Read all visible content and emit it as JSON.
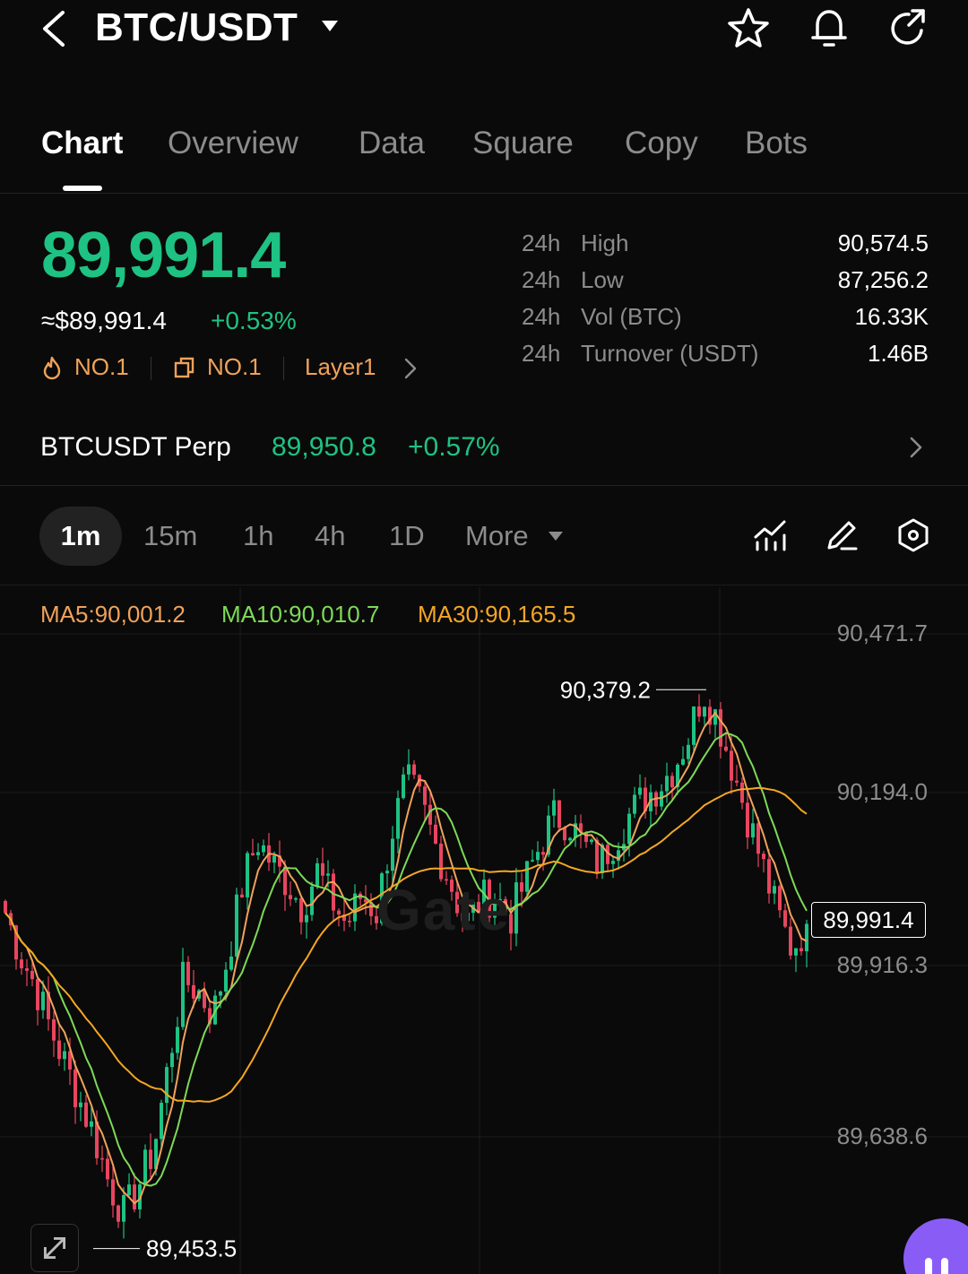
{
  "header": {
    "pair": "BTC/USDT"
  },
  "tabs": [
    {
      "label": "Chart",
      "active": true
    },
    {
      "label": "Overview"
    },
    {
      "label": "Data"
    },
    {
      "label": "Square"
    },
    {
      "label": "Copy"
    },
    {
      "label": "Bots"
    }
  ],
  "ticker": {
    "last_price": "89,991.4",
    "approx_usd": "≈$89,991.4",
    "change_pct": "+0.53%",
    "rank1": "NO.1",
    "rank2": "NO.1",
    "category": "Layer1"
  },
  "stats": [
    {
      "prefix": "24h",
      "label": "High",
      "value": "90,574.5"
    },
    {
      "prefix": "24h",
      "label": "Low",
      "value": "87,256.2"
    },
    {
      "prefix": "24h",
      "label": "Vol (BTC)",
      "value": "16.33K"
    },
    {
      "prefix": "24h",
      "label": "Turnover (USDT)",
      "value": "1.46B"
    }
  ],
  "perp": {
    "name": "BTCUSDT Perp",
    "price": "89,950.8",
    "change": "+0.57%"
  },
  "intervals": [
    {
      "label": "1m",
      "active": true
    },
    {
      "label": "15m"
    },
    {
      "label": "1h"
    },
    {
      "label": "4h"
    },
    {
      "label": "1D"
    },
    {
      "label": "More"
    }
  ],
  "ma": {
    "ma5": "MA5:90,001.2",
    "ma10": "MA10:90,010.7",
    "ma30": "MA30:90,165.5"
  },
  "colors": {
    "up": "#1ec283",
    "down": "#e8455f",
    "ma5": "#f0a25a",
    "ma10": "#7ed957",
    "ma30": "#f5a623",
    "accent_orange": "#f0a25a",
    "bot_purple": "#8a5cf6"
  },
  "chart": {
    "y_ticks": [
      "90,471.7",
      "90,194.0",
      "89,916.3",
      "89,638.6"
    ],
    "current_price": "89,991.4",
    "high_label": "90,379.2",
    "low_label": "89,453.5",
    "watermark": "Gate"
  },
  "chart_data": {
    "type": "candlestick",
    "interval": "1m",
    "y_range": [
      89400,
      90520
    ],
    "y_ticks": [
      90471.7,
      90194.0,
      89916.3,
      89638.6
    ],
    "last_price": 89991.4,
    "visible_high": 90379.2,
    "visible_low": 89453.5,
    "ma_latest": {
      "MA5": 90001.2,
      "MA10": 90010.7,
      "MA30": 90165.5
    },
    "close_path": [
      90010,
      89940,
      89890,
      89820,
      89760,
      89700,
      89640,
      89560,
      89510,
      89560,
      89620,
      89760,
      89900,
      89880,
      89840,
      89940,
      90060,
      90130,
      90090,
      90060,
      90020,
      90080,
      90030,
      89990,
      90040,
      90010,
      90140,
      90230,
      90190,
      90120,
      90060,
      89990,
      90030,
      90040,
      90000,
      90060,
      90120,
      90170,
      90160,
      90120,
      90090,
      90130,
      90170,
      90200,
      90220,
      90250,
      90300,
      90380,
      90330,
      90250,
      90170,
      90090,
      90010,
      89950,
      89990
    ]
  }
}
